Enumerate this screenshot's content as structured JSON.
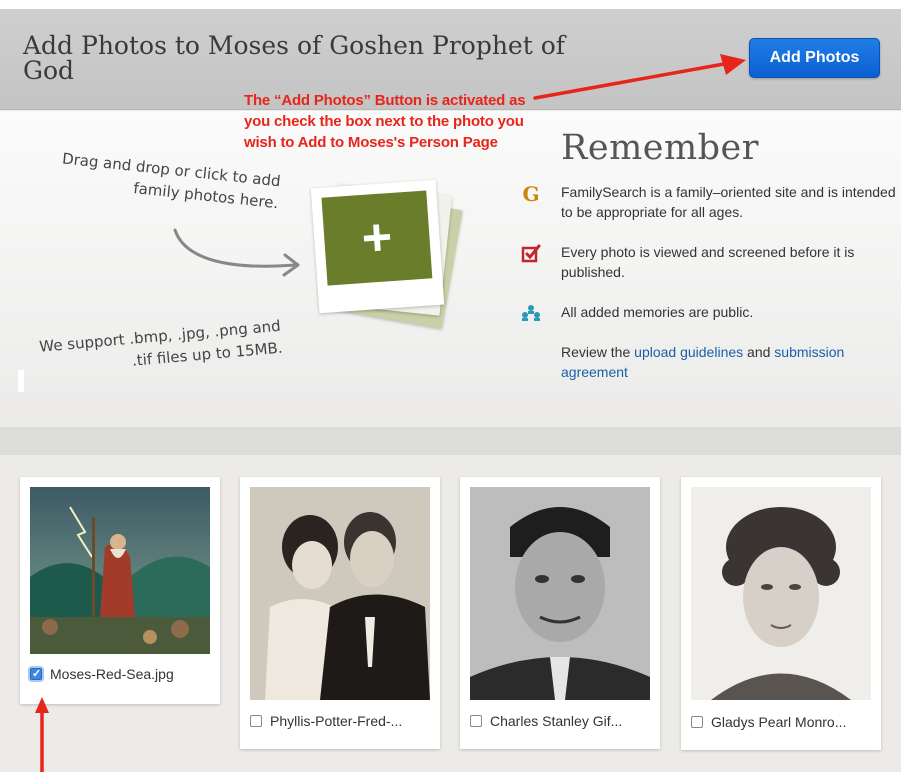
{
  "header": {
    "title": "Add Photos to Moses of Goshen Prophet of God",
    "add_button_label": "Add Photos"
  },
  "annotation": {
    "text": "The “Add Photos” Button is activated as you check the box next to the photo you wish to Add to Moses's Person Page"
  },
  "upload": {
    "drag_text": "Drag and drop or click to add family photos here.",
    "support_text": "We support .bmp, .jpg, .png and .tif files up to 15MB."
  },
  "remember": {
    "title": "Remember",
    "items": [
      {
        "icon": "familysearch-g-icon",
        "text": "FamilySearch is a family–oriented site and is intended to be appropriate for all ages."
      },
      {
        "icon": "screened-check-icon",
        "text": "Every photo is viewed and screened before it is published."
      },
      {
        "icon": "public-people-icon",
        "text": "All added memories are public."
      }
    ],
    "review": {
      "prefix": "Review the ",
      "link1": "upload guidelines",
      "middle": " and ",
      "link2": "submission agreement"
    }
  },
  "photos": [
    {
      "filename": "Moses-Red-Sea.jpg",
      "checked": true
    },
    {
      "filename": "Phyllis-Potter-Fred-...",
      "checked": false
    },
    {
      "filename": "Charles Stanley Gif...",
      "checked": false
    },
    {
      "filename": "Gladys Pearl Monro...",
      "checked": false
    }
  ],
  "colors": {
    "header_bg": "#c9c9c9",
    "button_blue": "#1570e0",
    "annotation_red": "#e8251b",
    "link_blue": "#1a5fa8",
    "plus_green": "#6a7d2b"
  }
}
